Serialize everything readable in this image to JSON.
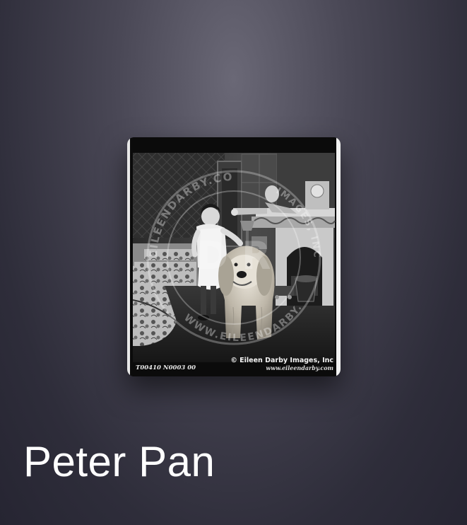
{
  "title": "Peter Pan",
  "cover": {
    "watermark_top": "EILEENDARBY.COM",
    "watermark_right": "IMAGES, INC",
    "watermark_bottom": "WWW.EILEENDARBY.COM",
    "watermark_letters": "D R",
    "frame_code": "T00410 N0003 00",
    "copyright": "© Eileen Darby Images, Inc",
    "website": "www.eileendarby.com"
  },
  "colors": {
    "title": "#ffffff",
    "background_top": "#6a6876",
    "background_bottom": "#262532"
  }
}
